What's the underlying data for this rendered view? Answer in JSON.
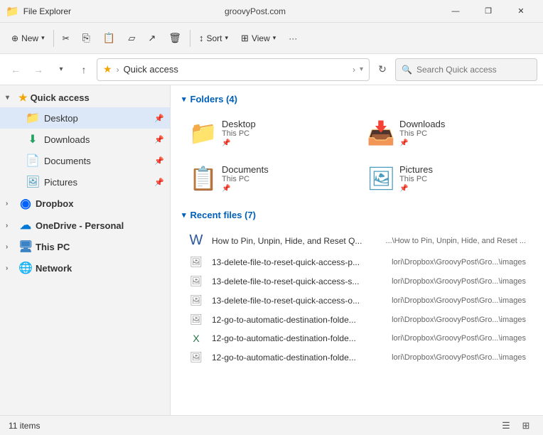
{
  "titlebar": {
    "title": "groovyPost.com",
    "app_name": "File Explorer",
    "min_label": "—",
    "max_label": "❐",
    "close_label": "✕"
  },
  "toolbar": {
    "new_label": "New",
    "cut_label": "",
    "copy_label": "",
    "paste_label": "",
    "rename_label": "",
    "share_label": "",
    "delete_label": "",
    "sort_label": "Sort",
    "view_label": "View",
    "more_label": "···"
  },
  "addressbar": {
    "back_label": "←",
    "forward_label": "→",
    "up_label": "↑",
    "recent_label": "▾",
    "star_label": "★",
    "path_sep": "›",
    "path_text": "Quick access",
    "path_trailing": "›",
    "chevron": "▾",
    "refresh_label": "↻",
    "search_placeholder": "Search Quick access"
  },
  "sidebar": {
    "quick_access_label": "Quick access",
    "items": [
      {
        "id": "desktop",
        "label": "Desktop",
        "pinned": true
      },
      {
        "id": "downloads",
        "label": "Downloads",
        "pinned": true
      },
      {
        "id": "documents",
        "label": "Documents",
        "pinned": true
      },
      {
        "id": "pictures",
        "label": "Pictures",
        "pinned": true
      }
    ],
    "groups": [
      {
        "id": "dropbox",
        "label": "Dropbox"
      },
      {
        "id": "onedrive",
        "label": "OneDrive - Personal"
      },
      {
        "id": "thispc",
        "label": "This PC"
      },
      {
        "id": "network",
        "label": "Network"
      }
    ]
  },
  "content": {
    "folders_section_label": "Folders (4)",
    "recent_section_label": "Recent files (7)",
    "folders": [
      {
        "id": "desktop",
        "name": "Desktop",
        "sub": "This PC",
        "pinned": true
      },
      {
        "id": "downloads",
        "name": "Downloads",
        "sub": "This PC",
        "pinned": true
      },
      {
        "id": "documents",
        "name": "Documents",
        "sub": "This PC",
        "pinned": true
      },
      {
        "id": "pictures",
        "name": "Pictures",
        "sub": "This PC",
        "pinned": true
      }
    ],
    "files": [
      {
        "id": "f1",
        "name": "How to Pin, Unpin, Hide, and Reset Q...",
        "path": "...\\How to Pin, Unpin, Hide, and Reset ...",
        "type": "word"
      },
      {
        "id": "f2",
        "name": "13-delete-file-to-reset-quick-access-p...",
        "path": "lori\\Dropbox\\GroovyPost\\Gro...\\images",
        "type": "image"
      },
      {
        "id": "f3",
        "name": "13-delete-file-to-reset-quick-access-s...",
        "path": "lori\\Dropbox\\GroovyPost\\Gro...\\images",
        "type": "image"
      },
      {
        "id": "f4",
        "name": "13-delete-file-to-reset-quick-access-o...",
        "path": "lori\\Dropbox\\GroovyPost\\Gro...\\images",
        "type": "image"
      },
      {
        "id": "f5",
        "name": "12-go-to-automatic-destination-folde...",
        "path": "lori\\Dropbox\\GroovyPost\\Gro...\\images",
        "type": "image"
      },
      {
        "id": "f6",
        "name": "12-go-to-automatic-destination-folde...",
        "path": "lori\\Dropbox\\GroovyPost\\Gro...\\images",
        "type": "excel"
      },
      {
        "id": "f7",
        "name": "12-go-to-automatic-destination-folde...",
        "path": "lori\\Dropbox\\GroovyPost\\Gro...\\images",
        "type": "image"
      }
    ]
  },
  "statusbar": {
    "items_label": "11 items"
  }
}
